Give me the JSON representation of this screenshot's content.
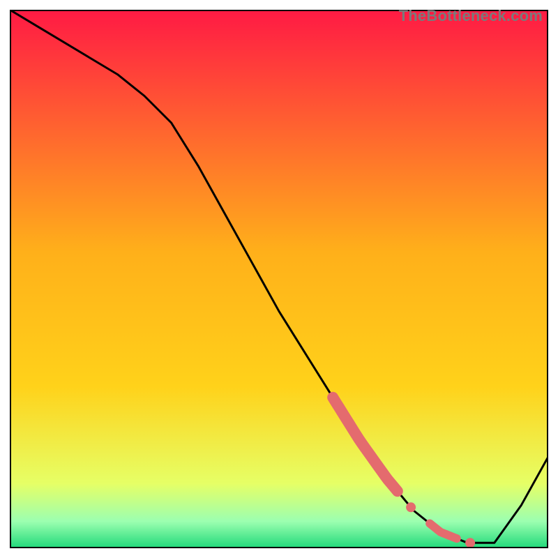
{
  "watermark": "TheBottleneck.com",
  "chart_data": {
    "type": "line",
    "title": "",
    "xlabel": "",
    "ylabel": "",
    "xlim": [
      0,
      100
    ],
    "ylim": [
      0,
      100
    ],
    "grid": false,
    "series": [
      {
        "name": "curve",
        "x": [
          0,
          5,
          10,
          15,
          20,
          25,
          30,
          35,
          40,
          45,
          50,
          55,
          60,
          65,
          70,
          75,
          80,
          85,
          90,
          95,
          100
        ],
        "y": [
          100,
          97,
          94,
          91,
          88,
          84,
          79,
          71,
          62,
          53,
          44,
          36,
          28,
          20,
          13,
          7,
          3,
          1,
          1,
          8,
          17
        ]
      }
    ],
    "highlighted_segments": [
      {
        "x_start": 60,
        "x_end": 72,
        "thickness": "heavy"
      },
      {
        "x_start": 73,
        "x_end": 76,
        "thickness": "dot"
      },
      {
        "x_start": 78,
        "x_end": 83,
        "thickness": "medium"
      },
      {
        "x_start": 85,
        "x_end": 86,
        "thickness": "dot"
      }
    ],
    "colors": {
      "curve": "#000000",
      "highlight": "#e46b6e",
      "frame": "#000000",
      "gradient_top": "#ff1a44",
      "gradient_mid": "#ffd21a",
      "gradient_low": "#e6ff66",
      "gradient_bottom": "#1fd97a"
    }
  }
}
